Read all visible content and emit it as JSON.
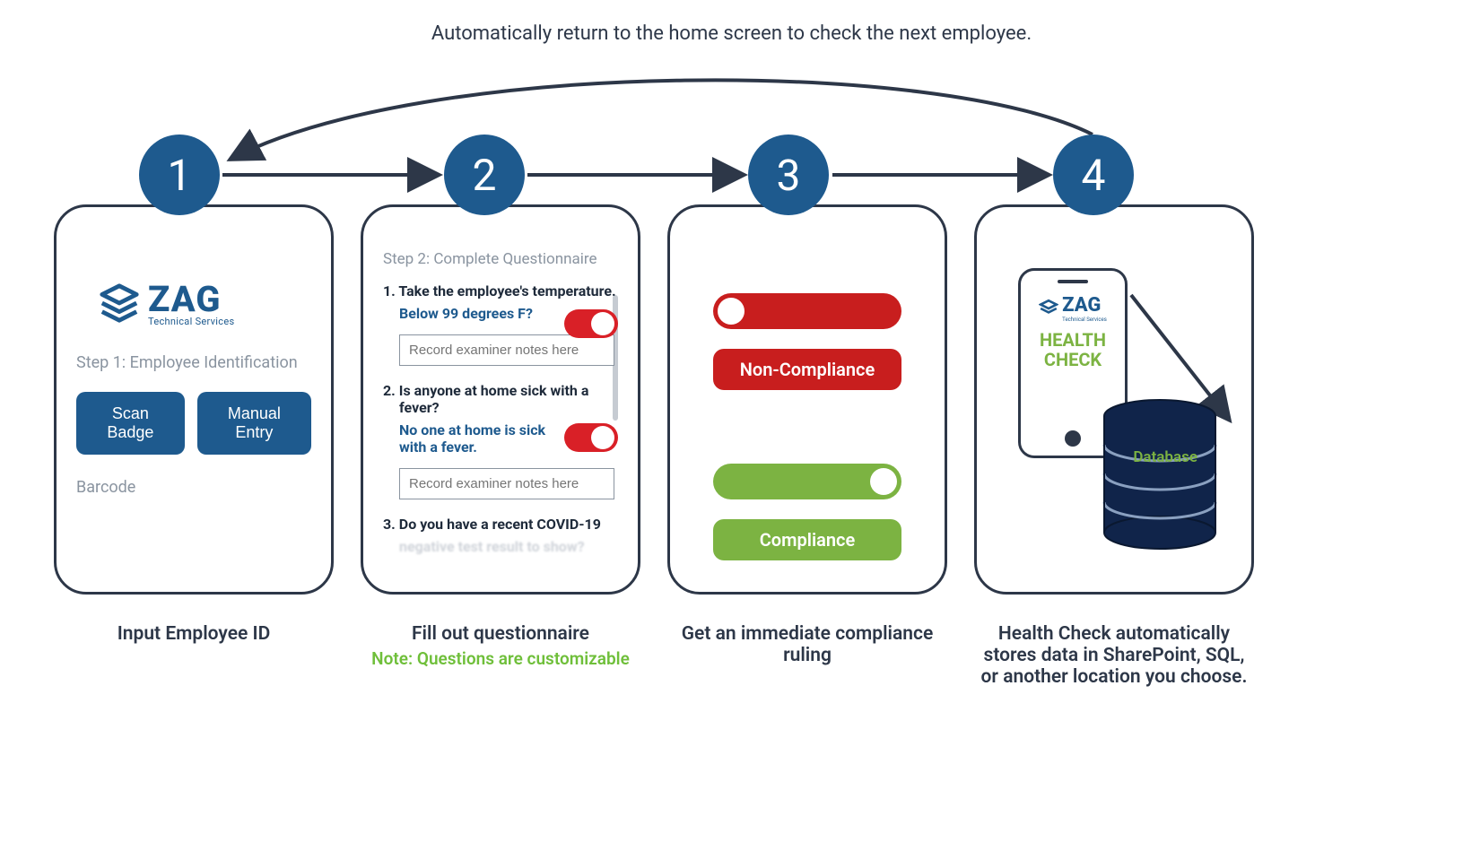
{
  "top_text": "Automatically return to the home screen to check the next employee.",
  "steps": {
    "s1": {
      "num": "1",
      "caption": "Input Employee ID"
    },
    "s2": {
      "num": "2",
      "caption": "Fill out questionnaire",
      "note": "Note: Questions are customizable"
    },
    "s3": {
      "num": "3",
      "caption": "Get an immediate compliance ruling"
    },
    "s4": {
      "num": "4",
      "caption": "Health Check automatically stores data in SharePoint, SQL, or another location you choose."
    }
  },
  "logo": {
    "main": "ZAG",
    "sub": "Technical Services"
  },
  "step1": {
    "label": "Step 1: Employee Identification",
    "btn_scan": "Scan Badge",
    "btn_manual": "Manual Entry",
    "barcode": "Barcode"
  },
  "step2": {
    "header": "Step 2: Complete Questionnaire",
    "q1_title": "1.  Take the employee's temperature.",
    "q1_sub": "Below 99 degrees F?",
    "q2_title": "2. Is anyone at home sick with a fever?",
    "q2_sub": "No one at home is sick with a fever.",
    "q3_title": "3.  Do you have a recent COVID-19",
    "q3_fade": "negative test result to show?",
    "notes_placeholder": "Record examiner notes here"
  },
  "step3": {
    "noncomp": "Non-Compliance",
    "comp": "Compliance"
  },
  "step4": {
    "hc": "HEALTH CHECK",
    "db": "Database"
  },
  "colors": {
    "primary": "#1e5a8e",
    "red": "#c81e1e",
    "toggleRed": "#d92027",
    "green": "#7cb342",
    "text": "#2d3748",
    "muted": "#8a94a0"
  }
}
